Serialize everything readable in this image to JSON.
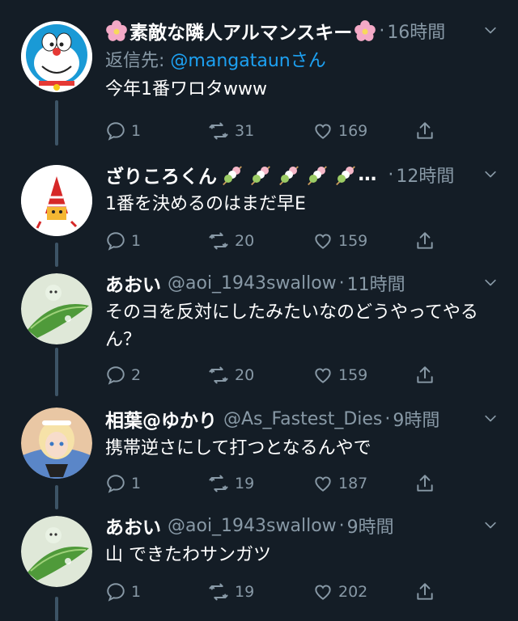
{
  "tweets": [
    {
      "name": "素敵な隣人アルマンスキー",
      "handle": "",
      "time": "16時間",
      "reply_prefix": "返信先: ",
      "reply_handle": "@mangataun",
      "reply_suffix": "さん",
      "text": "今年1番ワロタwww",
      "replies": "1",
      "retweets": "31",
      "likes": "169"
    },
    {
      "name": "ざりころくん",
      "name_suffix": "…",
      "handle": "",
      "time": "12時間",
      "text": "1番を決めるのはまだ早E",
      "replies": "1",
      "retweets": "20",
      "likes": "159"
    },
    {
      "name": "あおい",
      "handle": "@aoi_1943swallow",
      "time": "11時間",
      "text": "そのヨを反対にしたみたいなのどうやってやるん？",
      "replies": "2",
      "retweets": "20",
      "likes": "159"
    },
    {
      "name": "相葉@ゆかり",
      "handle": "@As_Fastest_Dies",
      "time": "9時間",
      "text": "携帯逆さにして打つとなるんやで",
      "replies": "1",
      "retweets": "19",
      "likes": "187"
    },
    {
      "name": "あおい",
      "handle": "@aoi_1943swallow",
      "time": "9時間",
      "text": "山 できたわサンガツ",
      "replies": "1",
      "retweets": "19",
      "likes": "202"
    }
  ],
  "colors": {
    "background": "#141d26",
    "secondary": "#8899a6",
    "link": "#1da1f2"
  },
  "icons": [
    "reply-icon",
    "retweet-icon",
    "like-icon",
    "share-icon",
    "chevron-down-icon",
    "sakura-emoji",
    "dango-emoji"
  ]
}
